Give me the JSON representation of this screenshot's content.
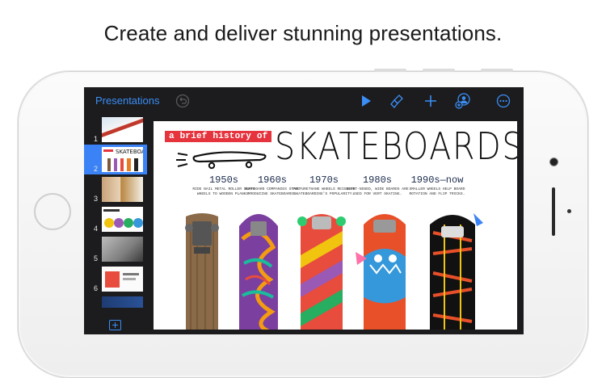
{
  "headline": "Create and deliver stunning presentations.",
  "toolbar": {
    "back_label": "Presentations"
  },
  "sidebar": {
    "thumbnails": [
      {
        "number": "1",
        "selected": false
      },
      {
        "number": "2",
        "selected": true
      },
      {
        "number": "3",
        "selected": false
      },
      {
        "number": "4",
        "selected": false
      },
      {
        "number": "5",
        "selected": false
      },
      {
        "number": "6",
        "selected": false
      },
      {
        "number": "",
        "selected": false
      }
    ]
  },
  "slide": {
    "tag": "a brief history of",
    "title": "SKATEBOARDS",
    "eras": [
      {
        "year": "1950s",
        "caption": "Ride nail metal roller skate wheels to wooden planks."
      },
      {
        "year": "1960s",
        "caption": "Surfboard companies start producing skateboards."
      },
      {
        "year": "1970s",
        "caption": "Polyurethane wheels reignite skateboarding's popularity."
      },
      {
        "year": "1980s",
        "caption": "Short-nosed, wide boards are used for vert skating."
      },
      {
        "year": "1990s—now",
        "caption": "Smaller wheels help board rotation and flip tricks."
      }
    ]
  },
  "colors": {
    "accent": "#3a82f6",
    "tag_red": "#e5343d",
    "toolbar_bg": "#1c1c1e"
  },
  "icons": [
    "undo-icon",
    "play-icon",
    "brush-icon",
    "plus-icon",
    "collaborate-icon",
    "more-icon"
  ]
}
